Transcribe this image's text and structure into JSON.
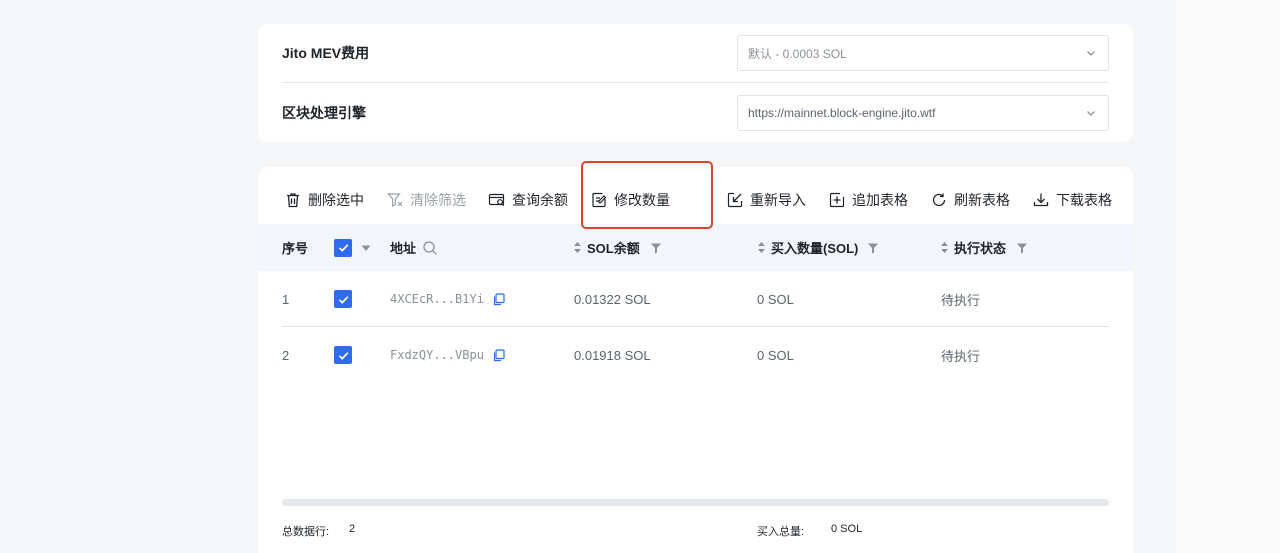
{
  "settings": {
    "jito_label": "Jito MEV费用",
    "jito_value": "默认 - 0.0003 SOL",
    "engine_label": "区块处理引擎",
    "engine_value": "https://mainnet.block-engine.jito.wtf"
  },
  "toolbar": {
    "delete_selected": "删除选中",
    "clear_filter": "清除筛选",
    "query_balance": "查询余额",
    "modify_quantity": "修改数量",
    "reimport": "重新导入",
    "append_table": "追加表格",
    "refresh_table": "刷新表格",
    "download_table": "下载表格"
  },
  "table": {
    "columns": {
      "index": "序号",
      "address": "地址",
      "sol_balance": "SOL余额",
      "buy_amount": "买入数量(SOL)",
      "status": "执行状态"
    },
    "rows": [
      {
        "index": "1",
        "address": "4XCEcR...B1Yi",
        "sol_balance": "0.01322 SOL",
        "buy_amount": "0 SOL",
        "status": "待执行"
      },
      {
        "index": "2",
        "address": "FxdzQY...VBpu",
        "sol_balance": "0.01918 SOL",
        "buy_amount": "0 SOL",
        "status": "待执行"
      }
    ]
  },
  "footer": {
    "total_rows_label": "总数据行:",
    "total_rows_value": "2",
    "total_buy_label": "买入总量:",
    "total_buy_value": "0 SOL"
  },
  "colors": {
    "accent": "#2f6bf0",
    "highlight": "#e0432e"
  }
}
